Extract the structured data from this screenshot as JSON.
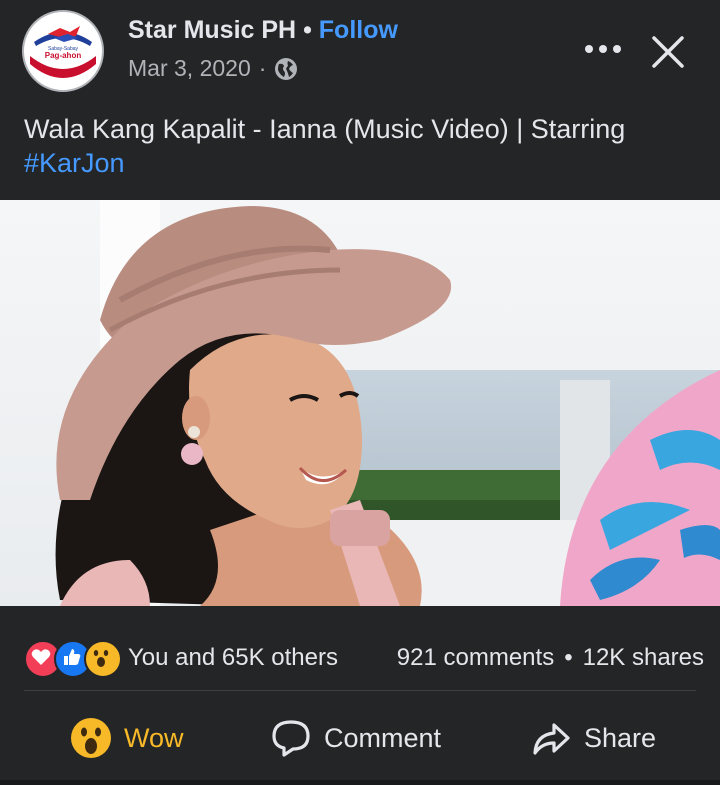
{
  "header": {
    "page_name": "Star Music PH",
    "separator": "•",
    "follow_label": "Follow",
    "date": "Mar 3, 2020",
    "date_separator": "·",
    "audience_icon": "globe-icon",
    "more_icon": "more-dots-icon",
    "close_icon": "close-icon",
    "avatar_text_top": "Sabay-Sabay",
    "avatar_text_mid": "Pag-ahon"
  },
  "caption": {
    "text": "Wala Kang Kapalit - Ianna (Music Video) | Starring ",
    "hashtag": "#KarJon"
  },
  "video": {
    "description_icon": "video-player"
  },
  "engagement": {
    "reaction_icons": [
      "love-reaction-icon",
      "like-reaction-icon",
      "wow-reaction-icon"
    ],
    "reactors_text": "You and 65K others",
    "comments_text": "921 comments",
    "counts_separator": "•",
    "shares_text": "12K shares"
  },
  "actions": {
    "wow_label": "Wow",
    "comment_label": "Comment",
    "share_label": "Share"
  },
  "colors": {
    "background": "#242526",
    "link_blue": "#4599ff",
    "wow_yellow": "#f7b928",
    "text_primary": "#e4e6eb",
    "text_secondary": "#b0b3b8"
  }
}
